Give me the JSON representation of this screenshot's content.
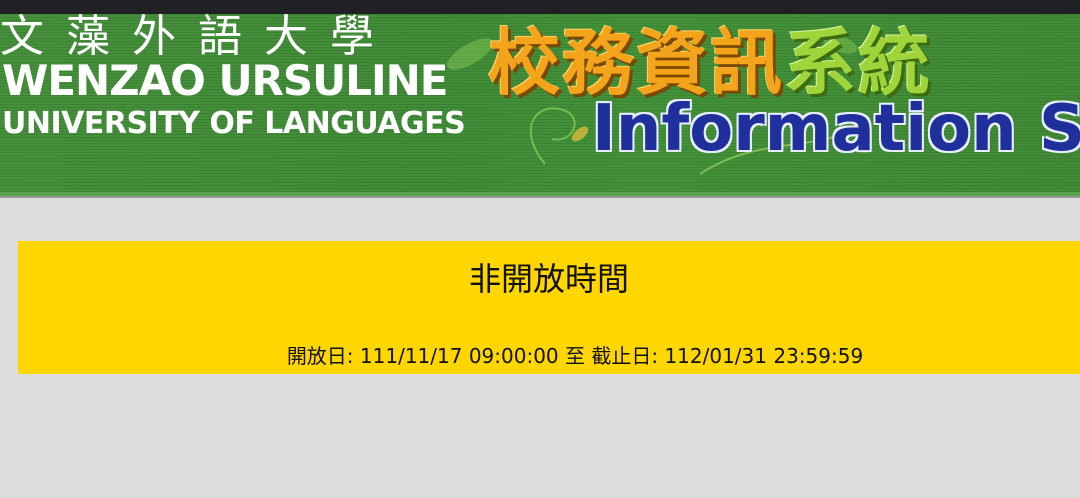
{
  "banner": {
    "school_cjk": "文藻外語大學",
    "school_en_line1": "WENZAO URSULINE",
    "school_en_line2": "UNIVERSITY OF LANGUAGES",
    "title_cjk_part1": "校務資訊",
    "title_cjk_part2": "系統",
    "title_en": "Information Syst",
    "bg_color": "#3d8b33"
  },
  "notice": {
    "heading": "非開放時間",
    "period": "開放日: 111/11/17 09:00:00 至 截止日: 112/01/31 23:59:59",
    "bg_color": "#ffd600"
  }
}
